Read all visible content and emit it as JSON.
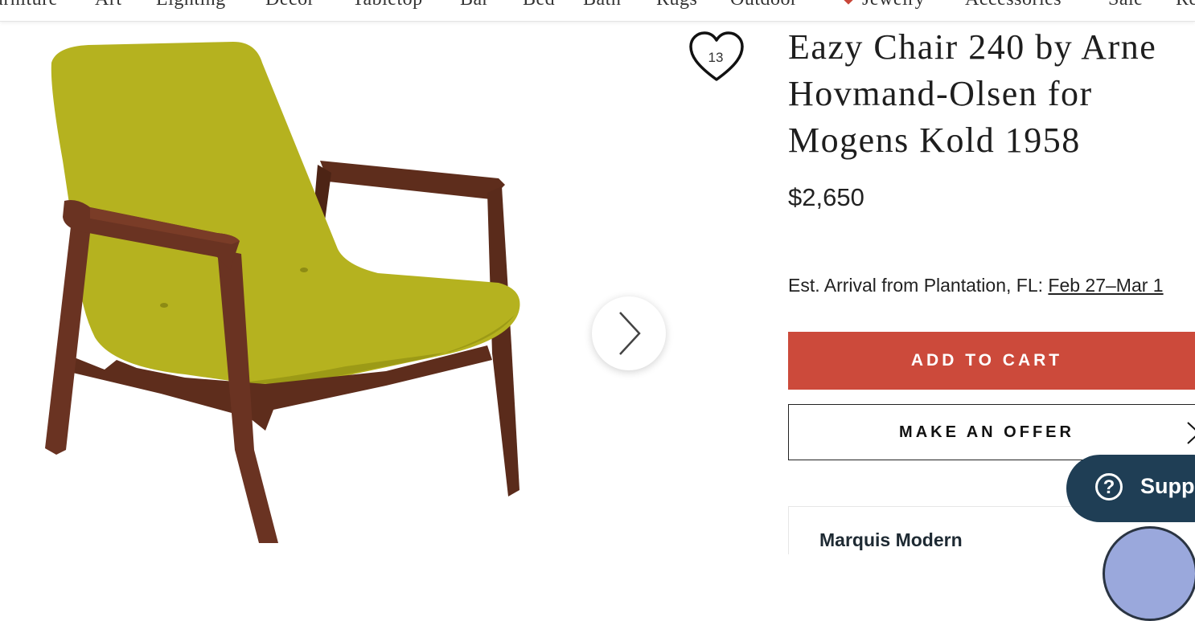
{
  "nav": {
    "items": [
      "Furniture",
      "Art",
      "Lighting",
      "Decor",
      "Tabletop",
      "Bar",
      "Bed",
      "Bath",
      "Rugs",
      "Outdoor",
      "Jewelry",
      "Accessories",
      "Sale",
      "Re"
    ]
  },
  "product": {
    "title": "Eazy Chair 240 by Arne Hovmand-Olsen for Mogens Kold 1958",
    "price": "$2,650",
    "favorite_count": "13",
    "arrival_label": "Est. Arrival from Plantation, FL:",
    "arrival_dates": "Feb 27–Mar 1"
  },
  "actions": {
    "add_to_cart": "ADD TO CART",
    "make_offer": "MAKE AN OFFER"
  },
  "dealer": {
    "name": "Marquis Modern"
  },
  "support": {
    "label": "Support"
  },
  "colors": {
    "cart_button": "#cc4a3b",
    "support_bg": "#1f3e55",
    "upholstery": "#b5b21f",
    "wood": "#6a3322"
  },
  "icons": {
    "favorite": "heart-icon",
    "next": "chevron-right-icon",
    "offer": "chevron-right-icon",
    "support": "question-icon"
  }
}
